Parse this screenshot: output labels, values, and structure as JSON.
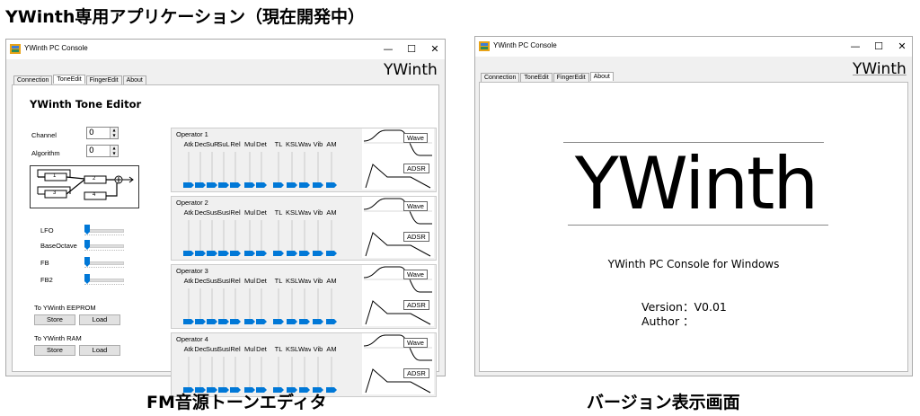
{
  "page_title": "YWinth専用アプリケーション（現在開発中）",
  "captions": {
    "left": "FM音源トーンエディタ",
    "right": "バージョン表示画面"
  },
  "left_window": {
    "title": "YWinth PC Console",
    "tabs": [
      "Connection",
      "ToneEdit",
      "FingerEdit",
      "About"
    ],
    "active_tab": "ToneEdit",
    "brand": "YWinth",
    "editor_heading": "YWinth Tone Editor",
    "channel": {
      "label": "Channel",
      "value": "0"
    },
    "algorithm": {
      "label": "Algorithm",
      "value": "0"
    },
    "algo_ops": [
      "1",
      "2",
      "3",
      "4"
    ],
    "sliders": [
      {
        "label": "LFO",
        "value": 0
      },
      {
        "label": "BaseOctave",
        "value": 0
      },
      {
        "label": "FB",
        "value": 0
      },
      {
        "label": "FB2",
        "value": 0
      }
    ],
    "eeprom": {
      "label": "To YWinth EEPROM",
      "store": "Store",
      "load": "Load"
    },
    "ram": {
      "label": "To YWinth RAM",
      "store": "Store",
      "load": "Load"
    },
    "operators": [
      {
        "name": "Operator 1",
        "params": [
          "Atk",
          "Dec",
          "SuR",
          "SuL",
          "Rel",
          "Mul",
          "Det",
          "TL",
          "KSL",
          "Wave",
          "Vib",
          "AM"
        ]
      },
      {
        "name": "Operator 2",
        "params": [
          "Atk",
          "Dec",
          "SusR",
          "SusL",
          "Rel",
          "Mul",
          "Det",
          "TL",
          "KSL",
          "Wave",
          "Vib",
          "AM"
        ]
      },
      {
        "name": "Operator 3",
        "params": [
          "Atk",
          "Dec",
          "SusR",
          "SusL",
          "Rel",
          "Mul",
          "Det",
          "TL",
          "KSL",
          "Wave",
          "Vib",
          "AM"
        ]
      },
      {
        "name": "Operator 4",
        "params": [
          "Atk",
          "Dec",
          "SusR",
          "SusL",
          "Rel",
          "Mul",
          "Det",
          "TL",
          "KSL",
          "Wave",
          "Vib",
          "AM"
        ]
      }
    ],
    "wave_label": "Wave",
    "adsr_label": "ADSR"
  },
  "right_window": {
    "title": "YWinth PC Console",
    "tabs": [
      "Connection",
      "ToneEdit",
      "FingerEdit",
      "About"
    ],
    "active_tab": "About",
    "brand": "YWinth",
    "logo": "YWinth",
    "subtitle": "YWinth PC Console for Windows",
    "version": "Version：V0.01",
    "author": "Author ："
  },
  "colors": {
    "accent": "#0078d7",
    "window_bg": "#f0f0f0"
  }
}
